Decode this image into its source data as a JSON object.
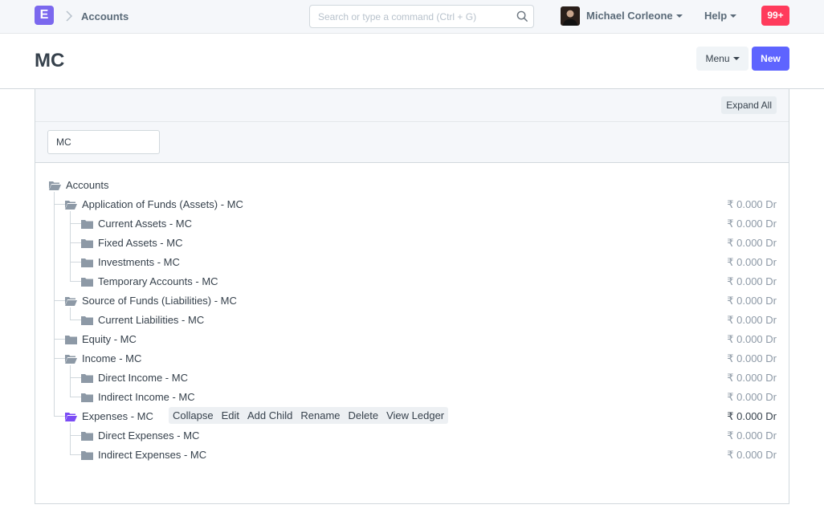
{
  "navbar": {
    "logo_letter": "E",
    "breadcrumb": "Accounts",
    "search_placeholder": "Search or type a command (Ctrl + G)",
    "user_name": "Michael Corleone",
    "help_label": "Help",
    "notification_count": "99+"
  },
  "page": {
    "title": "MC",
    "menu_label": "Menu",
    "new_label": "New"
  },
  "toolbar": {
    "expand_all_label": "Expand All",
    "company_value": "MC"
  },
  "tree": {
    "root": "Accounts",
    "nodes": [
      {
        "label": "Application of Funds (Assets) - MC",
        "balance": "₹ 0.000 Dr"
      },
      {
        "label": "Current Assets - MC",
        "balance": "₹ 0.000 Dr"
      },
      {
        "label": "Fixed Assets - MC",
        "balance": "₹ 0.000 Dr"
      },
      {
        "label": "Investments - MC",
        "balance": "₹ 0.000 Dr"
      },
      {
        "label": "Temporary Accounts - MC",
        "balance": "₹ 0.000 Dr"
      },
      {
        "label": "Source of Funds (Liabilities) - MC",
        "balance": "₹ 0.000 Dr"
      },
      {
        "label": "Current Liabilities - MC",
        "balance": "₹ 0.000 Dr"
      },
      {
        "label": "Equity - MC",
        "balance": "₹ 0.000 Dr"
      },
      {
        "label": "Income - MC",
        "balance": "₹ 0.000 Dr"
      },
      {
        "label": "Direct Income - MC",
        "balance": "₹ 0.000 Dr"
      },
      {
        "label": "Indirect Income - MC",
        "balance": "₹ 0.000 Dr"
      },
      {
        "label": "Expenses - MC",
        "balance": "₹ 0.000 Dr"
      },
      {
        "label": "Direct Expenses - MC",
        "balance": "₹ 0.000 Dr"
      },
      {
        "label": "Indirect Expenses - MC",
        "balance": "₹ 0.000 Dr"
      }
    ]
  },
  "node_actions": {
    "collapse": "Collapse",
    "edit": "Edit",
    "add_child": "Add Child",
    "rename": "Rename",
    "delete": "Delete",
    "view_ledger": "View Ledger"
  },
  "colors": {
    "accent": "#5e64ff",
    "logo": "#7b68ee",
    "notification": "#ff3b5c",
    "selected_folder": "#7b4cf5"
  }
}
